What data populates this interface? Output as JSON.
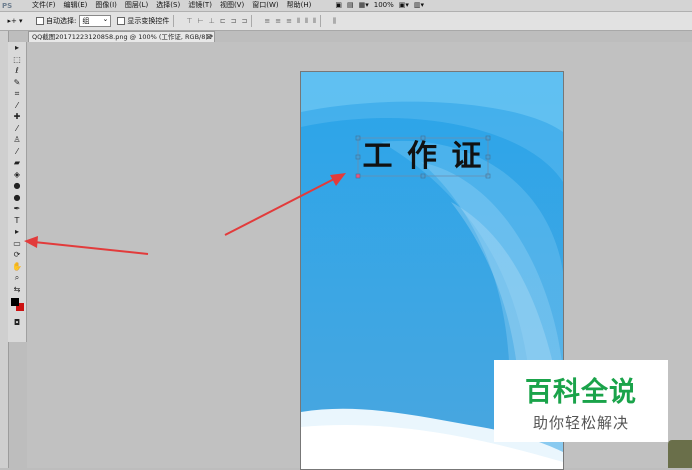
{
  "menu": {
    "logo": "PS",
    "items": [
      "文件(F)",
      "编辑(E)",
      "图像(I)",
      "图层(L)",
      "选择(S)",
      "滤镜(T)",
      "视图(V)",
      "窗口(W)",
      "帮助(H)"
    ],
    "zoom": "100%"
  },
  "options": {
    "auto_select_label": "自动选择:",
    "auto_select_value": "组",
    "show_transform_label": "显示变换控件"
  },
  "document": {
    "tab_title": "QQ截图20171223120858.png @ 100% (工作证, RGB/8) *",
    "card_text": "工 作 证"
  },
  "watermark": {
    "title": "百科全说",
    "subtitle": "助你轻松解决"
  },
  "colors": {
    "accent_green": "#1aa34a",
    "arrow_red": "#e23b3b",
    "fg_color": "#000000",
    "bg_color": "#cc1111"
  }
}
